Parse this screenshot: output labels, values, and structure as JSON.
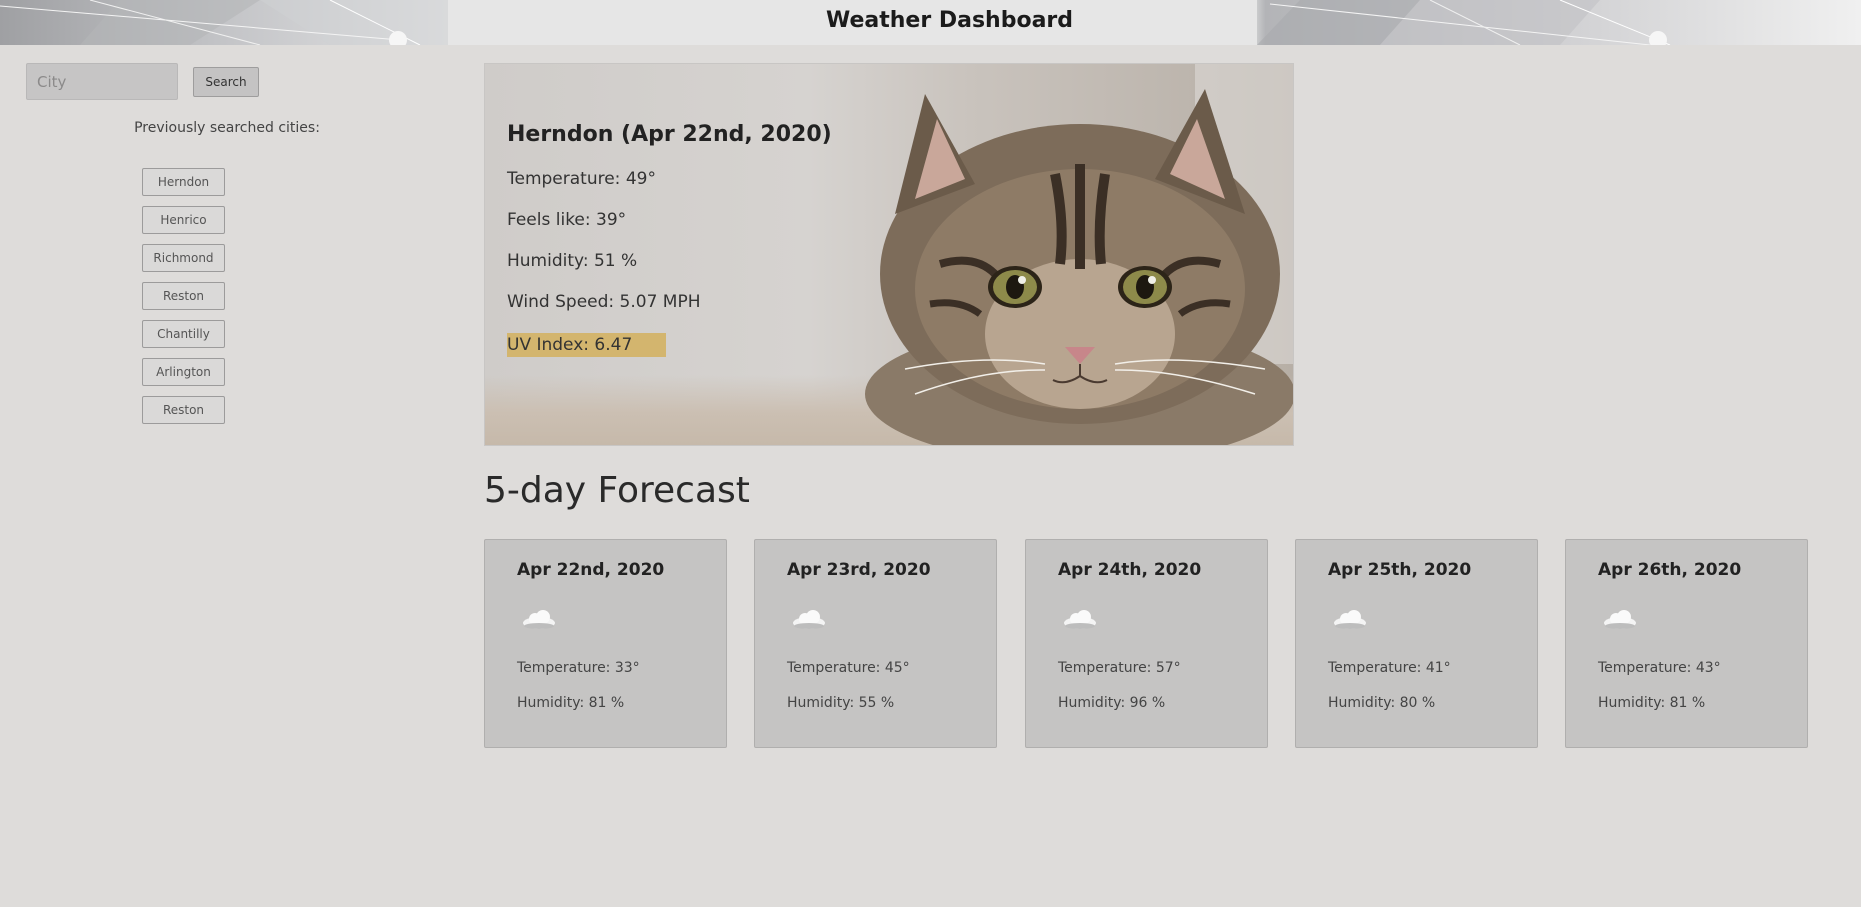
{
  "header": {
    "title": "Weather Dashboard"
  },
  "search": {
    "placeholder": "City",
    "button_label": "Search"
  },
  "history": {
    "label": "Previously searched cities:",
    "cities": [
      "Herndon",
      "Henrico",
      "Richmond",
      "Reston",
      "Chantilly",
      "Arlington",
      "Reston"
    ]
  },
  "current": {
    "heading": "Herndon (Apr 22nd, 2020)",
    "temperature": "Temperature: 49°",
    "feels_like": "Feels like: 39°",
    "humidity": "Humidity: 51 %",
    "wind": "Wind Speed: 5.07 MPH",
    "uv": "UV Index: 6.47",
    "uv_color": "#d3b56e",
    "background_image": "cat-photo"
  },
  "forecast": {
    "title": "5-day Forecast",
    "days": [
      {
        "date": "Apr 22nd, 2020",
        "icon": "cloud-icon",
        "temperature": "Temperature: 33°",
        "humidity": "Humidity: 81 %"
      },
      {
        "date": "Apr 23rd, 2020",
        "icon": "cloud-icon",
        "temperature": "Temperature: 45°",
        "humidity": "Humidity: 55 %"
      },
      {
        "date": "Apr 24th, 2020",
        "icon": "cloud-icon",
        "temperature": "Temperature: 57°",
        "humidity": "Humidity: 96 %"
      },
      {
        "date": "Apr 25th, 2020",
        "icon": "cloud-icon",
        "temperature": "Temperature: 41°",
        "humidity": "Humidity: 80 %"
      },
      {
        "date": "Apr 26th, 2020",
        "icon": "cloud-icon",
        "temperature": "Temperature: 43°",
        "humidity": "Humidity: 81 %"
      }
    ]
  }
}
